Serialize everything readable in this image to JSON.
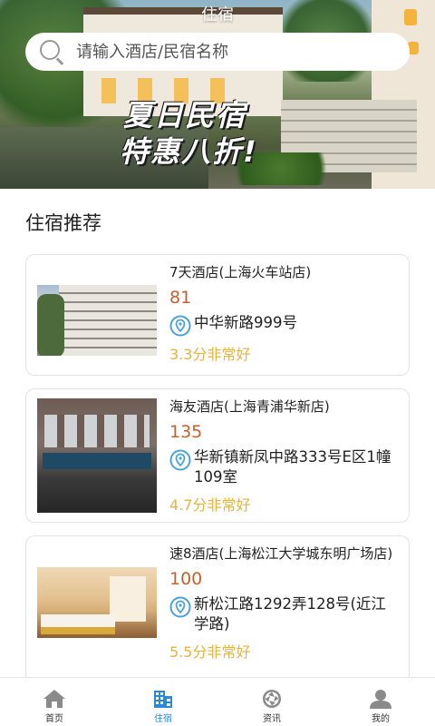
{
  "header": {
    "title": "住宿"
  },
  "search": {
    "placeholder": "请输入酒店/民宿名称",
    "icon": "search-icon"
  },
  "banner": {
    "line1": "夏日民宿",
    "line2": "特惠八折!"
  },
  "section": {
    "title": "住宿推荐"
  },
  "hotels": [
    {
      "name": "7天酒店(上海火车站店)",
      "price": "81",
      "address": "中华新路999号",
      "rating": "3.3分非常好"
    },
    {
      "name": "海友酒店(上海青浦华新店)",
      "price": "135",
      "address": "华新镇新凤中路333号E区1幢109室",
      "rating": "4.7分非常好"
    },
    {
      "name": "速8酒店(上海松江大学城东明广场店)",
      "price": "100",
      "address": "新松江路1292弄128号(近江学路)",
      "rating": "5.5分非常好"
    }
  ],
  "tabs": [
    {
      "label": "首页",
      "icon": "home-icon"
    },
    {
      "label": "住宿",
      "icon": "building-icon",
      "active": true
    },
    {
      "label": "资讯",
      "icon": "aperture-icon"
    },
    {
      "label": "我的",
      "icon": "user-icon"
    }
  ],
  "colors": {
    "accent": "#2a8ad8",
    "price": "#c8602b",
    "rating": "#e6b33e",
    "pin": "#4aa3d8"
  }
}
